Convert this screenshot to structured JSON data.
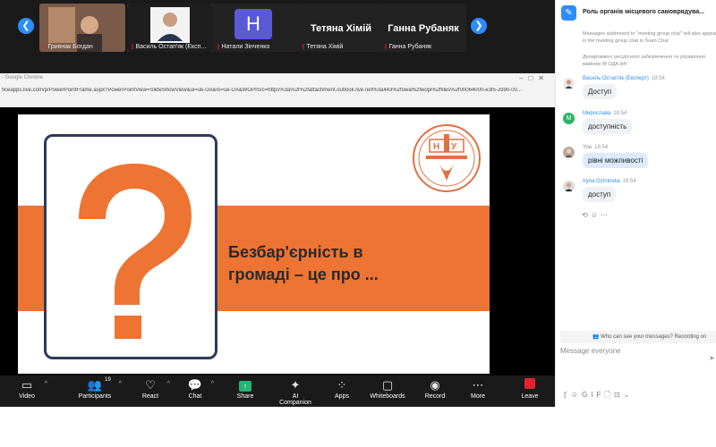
{
  "gallery": {
    "participants": [
      {
        "name": "Гривнак Богдан",
        "kind": "video"
      },
      {
        "name": "Василь Остап'як (Експ...",
        "kind": "video"
      },
      {
        "name": "Натали Зінченко",
        "kind": "avatar",
        "initial": "H"
      },
      {
        "name": "Тетяна Хімій",
        "kind": "name",
        "display": "Тетяна Хімій"
      },
      {
        "name": "Ганна Рубаняк",
        "kind": "name",
        "display": "Ганна Рубаняк"
      }
    ]
  },
  "browser": {
    "title": "- Google Chrome",
    "url": "ficeapps.live.com/p/PowerPointFrame.aspx?PowerPointView=SlideShowView&ui=uk-UA&rs=uk-UA&WOPISrc=https%3a%2f%2fattachment.outlook.live.net%3a443%2fowa%2fwopi%2ffiles%2f00064000-e3f5-2d90-00..."
  },
  "slide": {
    "title_line1": "Безбар'єрність в",
    "title_line2": "громаді – це про ...",
    "question_mark": "?",
    "accent_color": "#ed7433",
    "frame_color": "#2e3a5c"
  },
  "toolbar": {
    "video": "Video",
    "participants": "Participants",
    "participants_count": "19",
    "react": "React",
    "chat": "Chat",
    "share": "Share",
    "ai_companion": "AI Companion",
    "apps": "Apps",
    "whiteboards": "Whiteboards",
    "record": "Record",
    "more": "More",
    "leave": "Leave"
  },
  "chat": {
    "title": "Роль органів місцевого самоврядува...",
    "notice": "Messages addressed to \"meeting group chat\" will also appear in the meeting group chat in Team Chat",
    "system_message": "Департамент ресурсного забезпечення та управління майном ІФ ОДА left",
    "messages": [
      {
        "sender": "Василь Остап'як (Експерт)",
        "time": "18:54",
        "text": "Доступ",
        "avatar": "photo"
      },
      {
        "sender": "Мирослава",
        "time": "18:54",
        "text": "доступність",
        "avatar": "M"
      },
      {
        "sender": "You",
        "time": "18:54",
        "text": "рівні можливості",
        "avatar": "photo"
      },
      {
        "sender": "Iryna Ozminska",
        "time": "18:54",
        "text": "доступ",
        "avatar": "photo"
      }
    ],
    "who_can_see": "Who can see your messages? Recording on",
    "compose_placeholder": "Message everyone"
  }
}
